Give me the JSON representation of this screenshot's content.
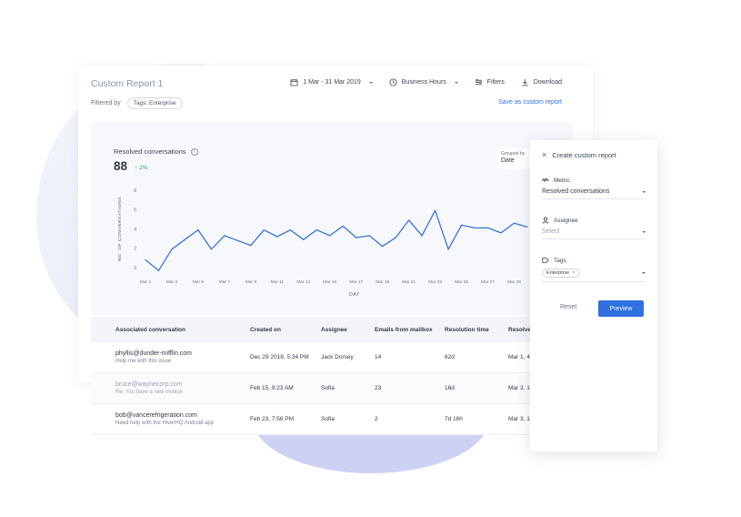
{
  "report": {
    "title": "Custom Report 1",
    "date_range": "1 Mar - 31 Mar 2019",
    "hours": "Business Hours",
    "filters_label": "Filters",
    "download_label": "Download",
    "filtered_by_label": "Filtered by",
    "filter_chip": "Tags: Enterprise",
    "save_link": "Save as custom report"
  },
  "metric": {
    "label": "Resolved conversations",
    "value": "88",
    "delta": "2%",
    "grouped_by_label": "Grouped by",
    "grouped_by_value": "Date"
  },
  "chart_data": {
    "type": "line",
    "xlabel": "DAY",
    "ylabel": "NO. OF CONVERSATIONS",
    "ylim": [
      0,
      8
    ],
    "y_ticks": [
      0,
      2,
      4,
      6,
      8
    ],
    "x_tick_labels": [
      "Mar 1",
      "Mar 3",
      "Mar 5",
      "Mar 7",
      "Mar 9",
      "Mar 11",
      "Mar 13",
      "Mar 15",
      "Mar 17",
      "Mar 19",
      "Mar 21",
      "Mar 23",
      "Mar 25",
      "Mar 27",
      "Mar 29"
    ],
    "x": [
      1,
      2,
      3,
      4,
      5,
      6,
      7,
      8,
      9,
      10,
      11,
      12,
      13,
      14,
      15,
      16,
      17,
      18,
      19,
      20,
      21,
      22,
      23,
      24,
      25,
      26,
      27,
      28,
      29,
      30
    ],
    "values": [
      0.8,
      -0.3,
      1.9,
      2.9,
      3.9,
      1.9,
      3.3,
      2.8,
      2.3,
      3.9,
      3.2,
      3.9,
      2.9,
      3.9,
      3.3,
      4.3,
      3.1,
      3.3,
      2.2,
      3.1,
      4.9,
      3.3,
      5.9,
      1.9,
      4.4,
      4.1,
      4.1,
      3.6,
      4.6,
      4.2
    ],
    "color": "#3b73d6"
  },
  "table": {
    "headers": [
      "Associated conversation",
      "Created on",
      "Assignee",
      "Emails from mailbox",
      "Resolution time",
      "Resolve"
    ],
    "rows": [
      {
        "email": "phyllis@dunder-mifflin.com",
        "sub": "Help me with this issue",
        "created": "Dec 29 2018, 5:34 PM",
        "assignee": "Jack Dorsey",
        "emails": "14",
        "resolution": "62d",
        "resolved": "Mar 1, 4"
      },
      {
        "email": "bruce@waynecorp.com",
        "sub": "Re: You have a new invoice",
        "created": "Feb 15, 9:23 AM",
        "assignee": "Sofia",
        "emails": "23",
        "resolution": "16d",
        "resolved": "Mar 3, 1"
      },
      {
        "email": "bob@vancerefrigeration.com",
        "sub": "Need help with the HiverHQ Android app",
        "created": "Feb 23, 7:56 PM",
        "assignee": "Sofia",
        "emails": "2",
        "resolution": "7d 16h",
        "resolved": "Mar 3, 1"
      }
    ]
  },
  "side_panel": {
    "title": "Create custom report",
    "metric_label": "Metric",
    "metric_value": "Resolved conversations",
    "assignee_label": "Assignee",
    "assignee_placeholder": "Select",
    "tags_label": "Tags",
    "tag_value": "Enterprise",
    "reset_label": "Reset",
    "preview_label": "Preview"
  },
  "colors": {
    "accent": "#2f6fe0",
    "positive": "#2ea84a",
    "line": "#3b73d6"
  }
}
